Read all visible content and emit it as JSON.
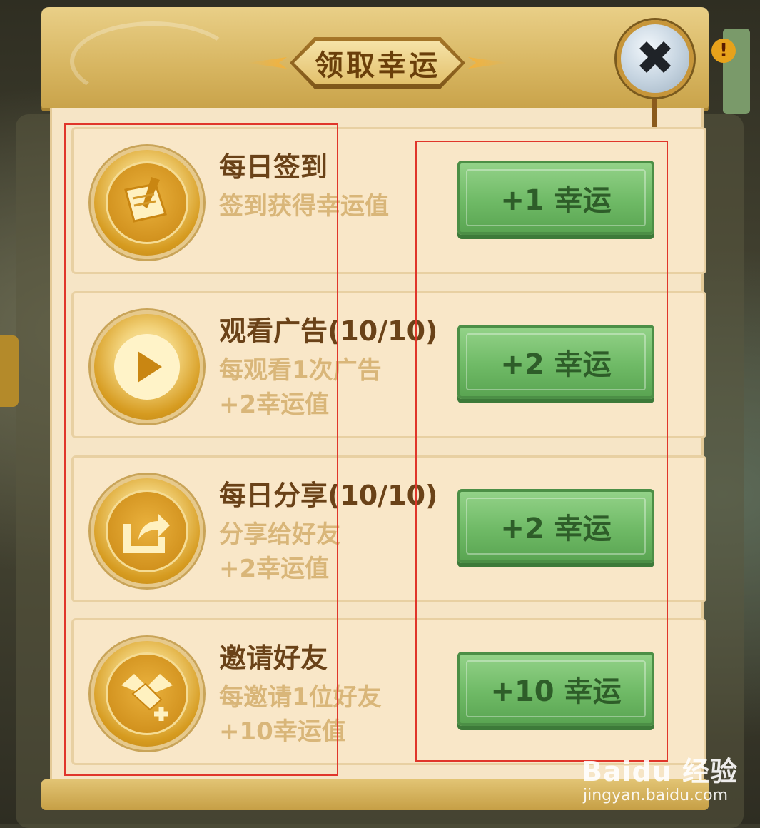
{
  "dialog": {
    "title": "领取幸运",
    "close_glyph": "✖",
    "close_icon": "close-icon"
  },
  "background": {
    "alert_glyph": "!"
  },
  "rows": [
    {
      "title": "每日签到",
      "desc": "签到获得幸运值",
      "button": "+1 幸运",
      "icon": "scroll-quill-icon"
    },
    {
      "title": "观看广告(10/10)",
      "desc": "每观看1次广告\n+2幸运值",
      "button": "+2 幸运",
      "icon": "play-icon"
    },
    {
      "title": "每日分享(10/10)",
      "desc": "分享给好友\n+2幸运值",
      "button": "+2 幸运",
      "icon": "share-icon"
    },
    {
      "title": "邀请好友",
      "desc": "每邀请1位好友\n+10幸运值",
      "button": "+10 幸运",
      "icon": "handshake-icon"
    }
  ],
  "watermark": {
    "logo": "Baidu 经验",
    "url": "jingyan.baidu.com"
  },
  "colors": {
    "panel_body": "#f6e5c6",
    "header_gold": "#d7b560",
    "button_green": "#6fba66",
    "title_brown": "#6a4218",
    "desc_tan": "#d9b679",
    "annotation_red": "#e0362a"
  }
}
